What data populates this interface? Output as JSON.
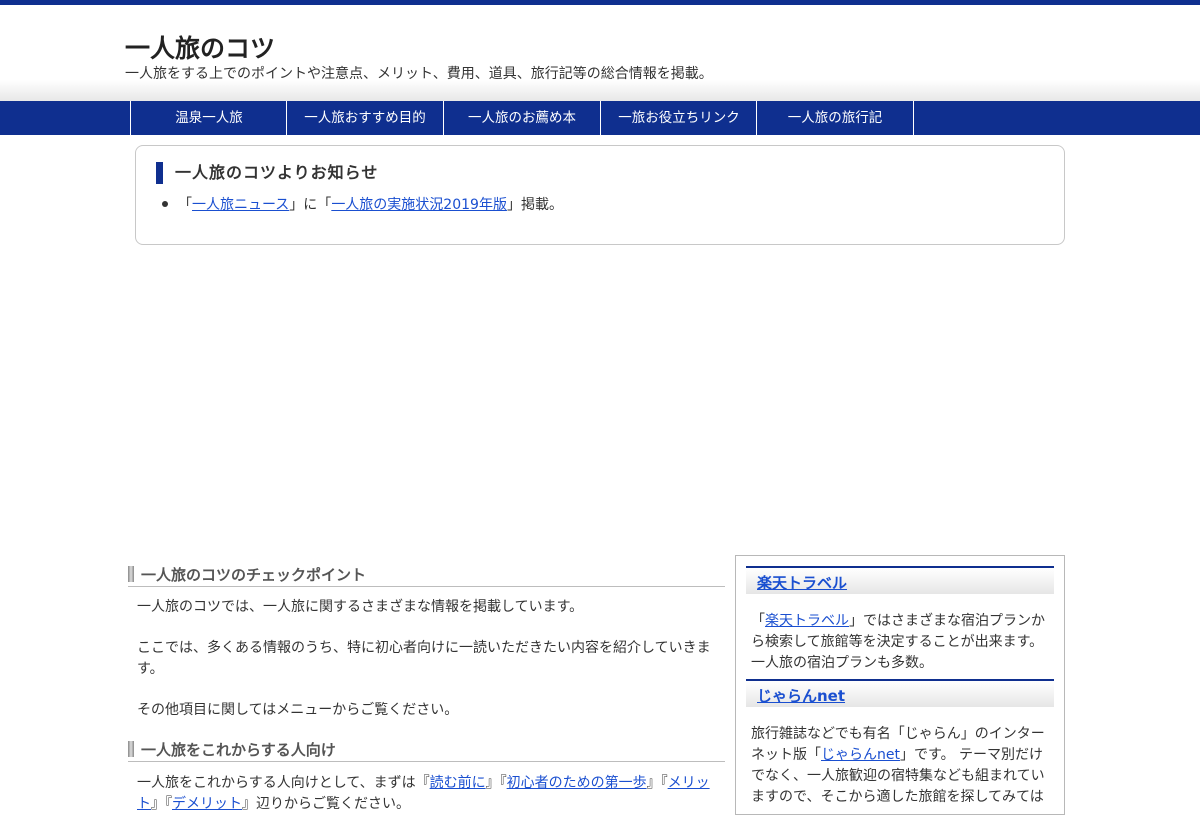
{
  "site": {
    "title": "一人旅のコツ",
    "description": "一人旅をする上でのポイントや注意点、メリット、費用、道具、旅行記等の総合情報を掲載。"
  },
  "nav": {
    "items": [
      "温泉一人旅",
      "一人旅おすすめ目的",
      "一人旅のお薦め本",
      "一旅お役立ちリンク",
      "一人旅の旅行記"
    ]
  },
  "notice": {
    "title": "一人旅のコツよりお知らせ",
    "item": {
      "p1": "「",
      "link1": "一人旅ニュース",
      "p2": "」に「",
      "link2": "一人旅の実施状況2019年版",
      "p3": "」掲載。"
    }
  },
  "main": {
    "section1": {
      "heading": "一人旅のコツのチェックポイント",
      "p1": "一人旅のコツでは、一人旅に関するさまざまな情報を掲載しています。",
      "p2": "ここでは、多くある情報のうち、特に初心者向けに一読いただきたい内容を紹介していきます。",
      "p3": "その他項目に関してはメニューからご覧ください。"
    },
    "section2": {
      "heading": "一人旅をこれからする人向け",
      "text_start": "一人旅をこれからする人向けとして、まずは『",
      "link1": "読む前に",
      "sep1": "』『",
      "link2": "初心者のための第一歩",
      "sep2": "』『",
      "link3": "メリット",
      "sep3": "』『",
      "link4": "デメリット",
      "text_end": "』辺りからご覧ください。"
    }
  },
  "sidebar": {
    "rakuten": {
      "heading": "楽天トラベル",
      "t1": "「",
      "link": "楽天トラベル",
      "t2": "」ではさまざまな宿泊プランから検索して旅館等を決定することが出来ます。一人旅の宿泊プランも多数。"
    },
    "jalan": {
      "heading": "じゃらんnet",
      "t1": "旅行雑誌などでも有名「じゃらん」のインターネット版「",
      "link": "じゃらんnet",
      "t2": "」です。 テーマ別だけでなく、一人旅歓迎の宿特集なども組まれていますので、そこから適した旅館を探してみては"
    }
  },
  "colors": {
    "brand_navy": "#0f2f8f",
    "link": "#1a4fd0"
  }
}
